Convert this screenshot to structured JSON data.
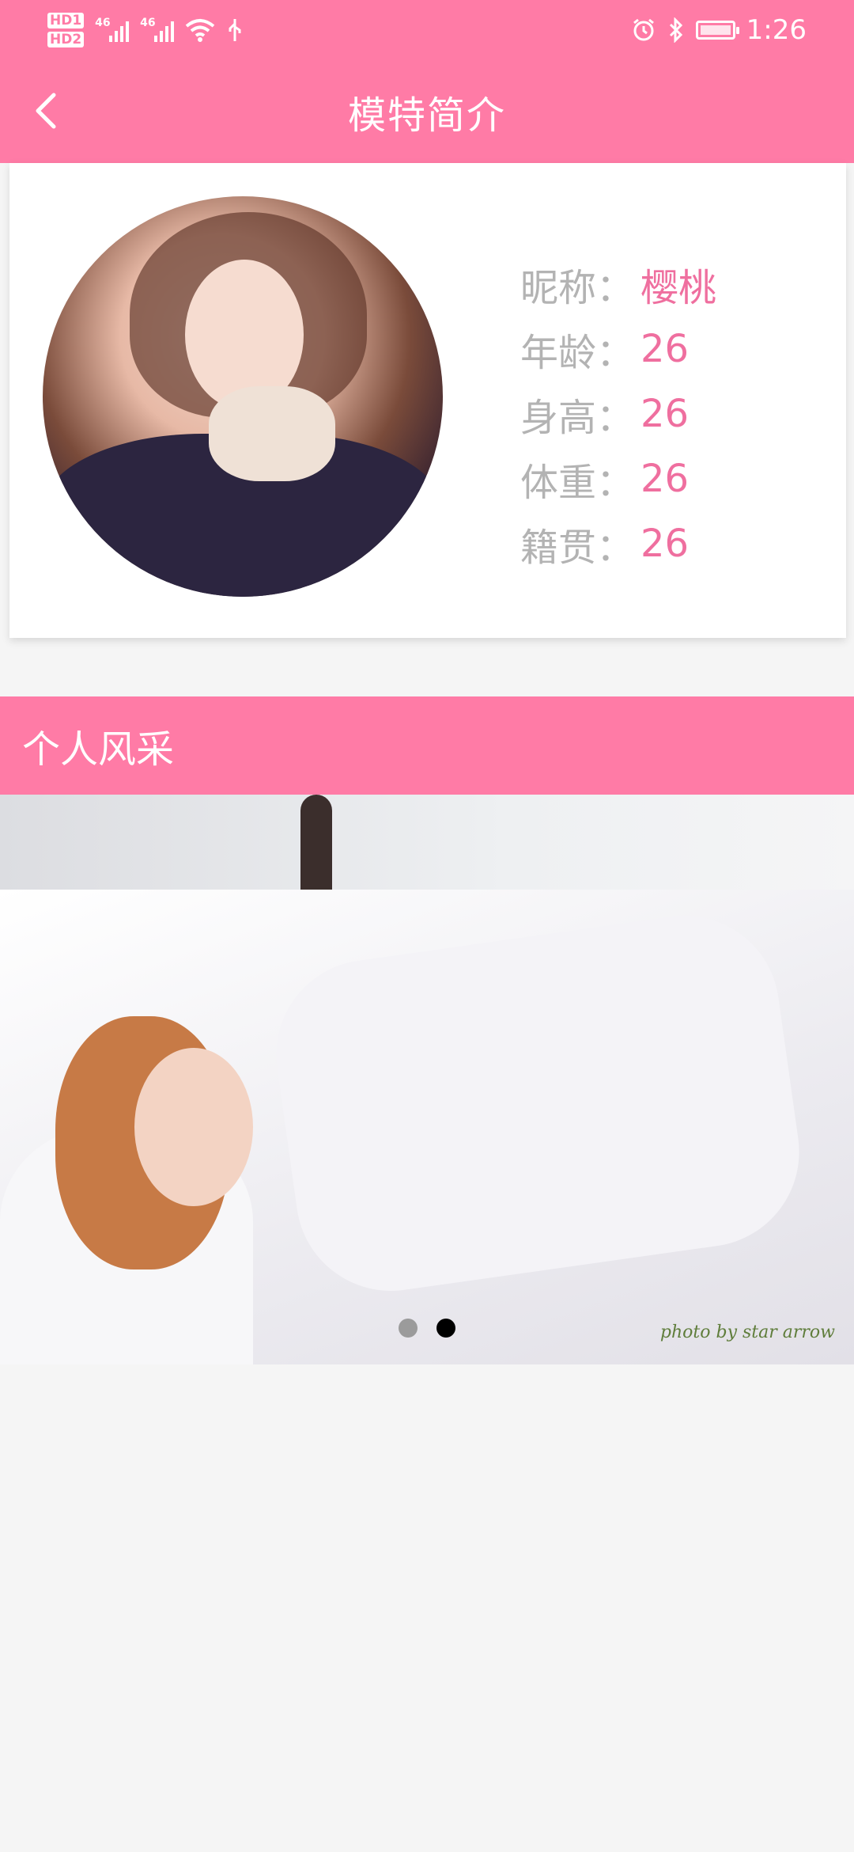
{
  "status_bar": {
    "time": "1:26",
    "hd1": "HD1",
    "hd2": "HD2",
    "network1": "46",
    "network2": "46"
  },
  "app_bar": {
    "title": "模特简介"
  },
  "profile": {
    "fields": [
      {
        "label": "昵称：",
        "value": "樱桃"
      },
      {
        "label": "年龄：",
        "value": "26"
      },
      {
        "label": "身高：",
        "value": "26"
      },
      {
        "label": "体重：",
        "value": "26"
      },
      {
        "label": "籍贯：",
        "value": "26"
      }
    ]
  },
  "section": {
    "title": "个人风采"
  },
  "gallery": {
    "watermark": "photo by star arrow",
    "page_count": 2,
    "active_index": 1
  },
  "colors": {
    "accent": "#ff7ba6",
    "value_text": "#ef6f9f",
    "label_text": "#b3b3b3"
  }
}
